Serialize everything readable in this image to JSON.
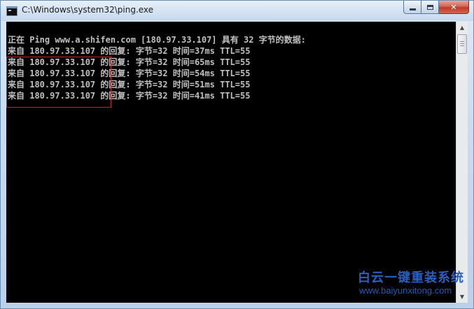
{
  "window": {
    "title": "C:\\Windows\\system32\\ping.exe",
    "icon": "cmd-console-icon",
    "caption_buttons": {
      "minimize": "minimize-icon",
      "maximize": "maximize-icon",
      "close_label": "✕"
    }
  },
  "console": {
    "lines": [
      "正在 Ping www.a.shifen.com [180.97.33.107] 具有 32 字节的数据:",
      "来自 180.97.33.107 的回复: 字节=32 时间=37ms TTL=55",
      "来自 180.97.33.107 的回复: 字节=32 时间=65ms TTL=55",
      "来自 180.97.33.107 的回复: 字节=32 时间=54ms TTL=55",
      "来自 180.97.33.107 的回复: 字节=32 时间=51ms TTL=55",
      "来自 180.97.33.107 的回复: 字节=32 时间=41ms TTL=55"
    ],
    "text_color": "#c0c0c0",
    "background_color": "#000000",
    "highlight_color": "#d02020"
  },
  "scrollbar": {
    "up_arrow": "▲",
    "down_arrow": "▼"
  },
  "watermark": {
    "name": "白云一键重装系统",
    "url": "www.baiyunxitong.com",
    "color": "#2a5fc4"
  }
}
